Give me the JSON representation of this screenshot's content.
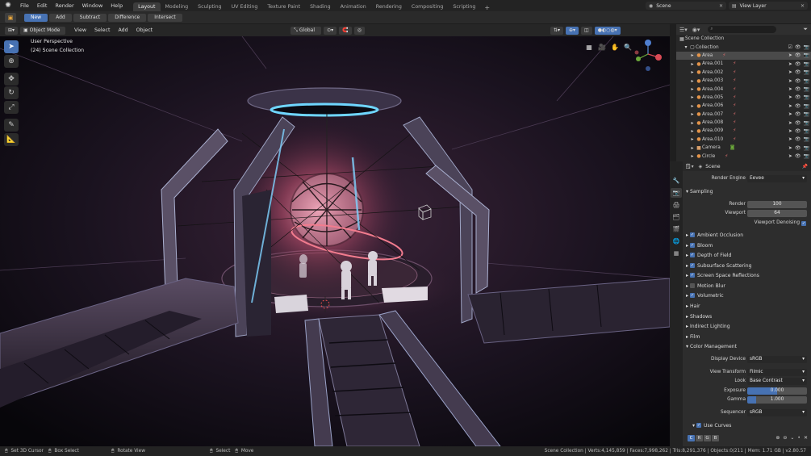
{
  "topbar": {
    "menu": [
      "File",
      "Edit",
      "Render",
      "Window",
      "Help"
    ],
    "workspaces": [
      "Layout",
      "Modeling",
      "Sculpting",
      "UV Editing",
      "Texture Paint",
      "Shading",
      "Animation",
      "Rendering",
      "Compositing",
      "Scripting"
    ],
    "active_workspace": "Layout",
    "scene": "Scene",
    "view_layer": "View Layer"
  },
  "toolheader": {
    "buttons": [
      "New",
      "Add",
      "Subtract",
      "Difference",
      "Intersect"
    ],
    "active": "New"
  },
  "viewport_header": {
    "mode": "Object Mode",
    "menus": [
      "View",
      "Select",
      "Add",
      "Object"
    ],
    "orientation": "Global"
  },
  "viewport": {
    "title": "User Perspective",
    "collection": "(24) Scene Collection"
  },
  "outliner": {
    "root": "Scene Collection",
    "collection": "Collection",
    "items": [
      "Area",
      "Area.001",
      "Area.002",
      "Area.003",
      "Area.004",
      "Area.005",
      "Area.006",
      "Area.007",
      "Area.008",
      "Area.009",
      "Area.010",
      "Camera",
      "Circle"
    ],
    "selected": "Area"
  },
  "properties": {
    "scene_label": "Scene",
    "render_engine_label": "Render Engine",
    "render_engine": "Eevee",
    "sampling": "Sampling",
    "render_label": "Render",
    "render_samples": "100",
    "viewport_label": "Viewport",
    "viewport_samples": "64",
    "viewport_denoising": "Viewport Denoising",
    "effects": [
      {
        "label": "Ambient Occlusion",
        "on": true
      },
      {
        "label": "Bloom",
        "on": true
      },
      {
        "label": "Depth of Field",
        "on": true
      },
      {
        "label": "Subsurface Scattering",
        "on": true
      },
      {
        "label": "Screen Space Reflections",
        "on": true
      },
      {
        "label": "Motion Blur",
        "on": false
      },
      {
        "label": "Volumetric",
        "on": true
      }
    ],
    "panels": [
      "Hair",
      "Shadows",
      "Indirect Lighting",
      "Film"
    ],
    "color_management": "Color Management",
    "display_device_label": "Display Device",
    "display_device": "sRGB",
    "view_transform_label": "View Transform",
    "view_transform": "Filmic",
    "look_label": "Look",
    "look": "Base Contrast",
    "exposure_label": "Exposure",
    "exposure": "0.000",
    "gamma_label": "Gamma",
    "gamma": "1.000",
    "gamma_fill": 0.15,
    "sequencer_label": "Sequencer",
    "sequencer": "sRGB",
    "use_curves": "Use Curves",
    "curve_channels": [
      "C",
      "R",
      "G",
      "B"
    ]
  },
  "statusbar": {
    "set_cursor": "Set 3D Cursor",
    "box_select": "Box Select",
    "rotate_view": "Rotate View",
    "select": "Select",
    "move": "Move",
    "stats": "Scene Collection | Verts:4,145,859 | Faces:7,998,262 | Tris:8,291,376 | Objects:0/211 | Mem: 1.71 GB | v2.80.57"
  }
}
